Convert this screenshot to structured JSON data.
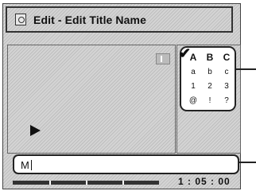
{
  "window": {
    "title": "Edit - Edit Title Name",
    "title_icon": "disc-edit-icon"
  },
  "preview": {
    "chapter_icon": "chapter-marker-icon",
    "play_icon": "play-icon"
  },
  "keyboard": {
    "selected_indicator": "checkmark-icon",
    "rows": [
      [
        "A",
        "B",
        "C"
      ],
      [
        "a",
        "b",
        "c"
      ],
      [
        "1",
        "2",
        "3"
      ],
      [
        "@",
        "!",
        "?"
      ]
    ]
  },
  "title_input": {
    "value": "M"
  },
  "playback": {
    "time": "1 : 05 : 00"
  }
}
